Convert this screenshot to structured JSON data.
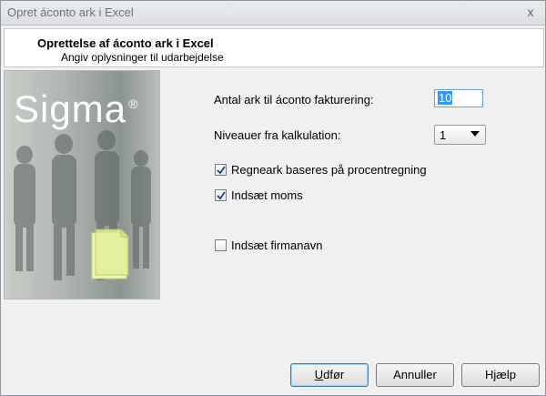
{
  "window": {
    "title": "Opret áconto ark i Excel",
    "close_glyph": "x"
  },
  "header": {
    "title": "Oprettelse af áconto ark i Excel",
    "subtitle": "Angiv oplysninger til udarbejdelse"
  },
  "side_image": {
    "brand": "Sigma",
    "brand_mark": "®"
  },
  "fields": {
    "antal_ark_label": "Antal ark til áconto fakturering:",
    "antal_ark_value": "10",
    "niveauer_label": "Niveauer fra kalkulation:",
    "niveauer_value": "1"
  },
  "checkboxes": [
    {
      "label": "Regneark baseres på procentregning",
      "checked": true
    },
    {
      "label": "Indsæt moms",
      "checked": true
    },
    {
      "label": "Indsæt firmanavn",
      "checked": false
    }
  ],
  "buttons": {
    "finish_first": "U",
    "finish_rest": "dfør",
    "cancel": "Annuller",
    "help": "Hjælp"
  }
}
